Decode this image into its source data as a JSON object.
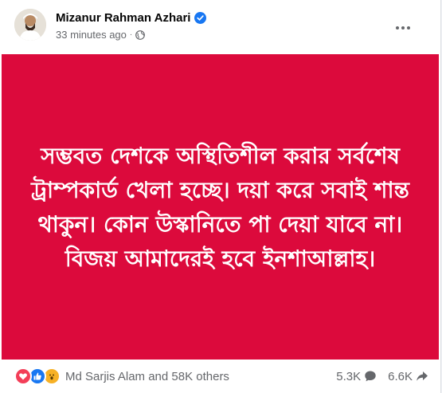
{
  "post": {
    "author": "Mizanur Rahman Azhari",
    "time": "33 minutes ago",
    "separator": "·",
    "text": "সম্ভবত দেশকে অস্থিতিশীল করার সর্বশেষ ট্রাম্পকার্ড খেলা হচ্ছে। দয়া করে সবাই শান্ত থাকুন। কোন উস্কানিতে পা দেয়া যাবে না। বিজয় আমাদেরই হবে ইনশাআল্লাহ।",
    "background_color": "#dc0a3c"
  },
  "footer": {
    "reactions_label": "Md Sarjis Alam and 58K others",
    "comments_count": "5.3K",
    "shares_count": "6.6K"
  },
  "icons": [
    "verified-badge-icon",
    "globe-icon",
    "more-options-icon",
    "love-reaction-icon",
    "like-reaction-icon",
    "wow-reaction-icon",
    "comment-icon",
    "share-icon"
  ]
}
